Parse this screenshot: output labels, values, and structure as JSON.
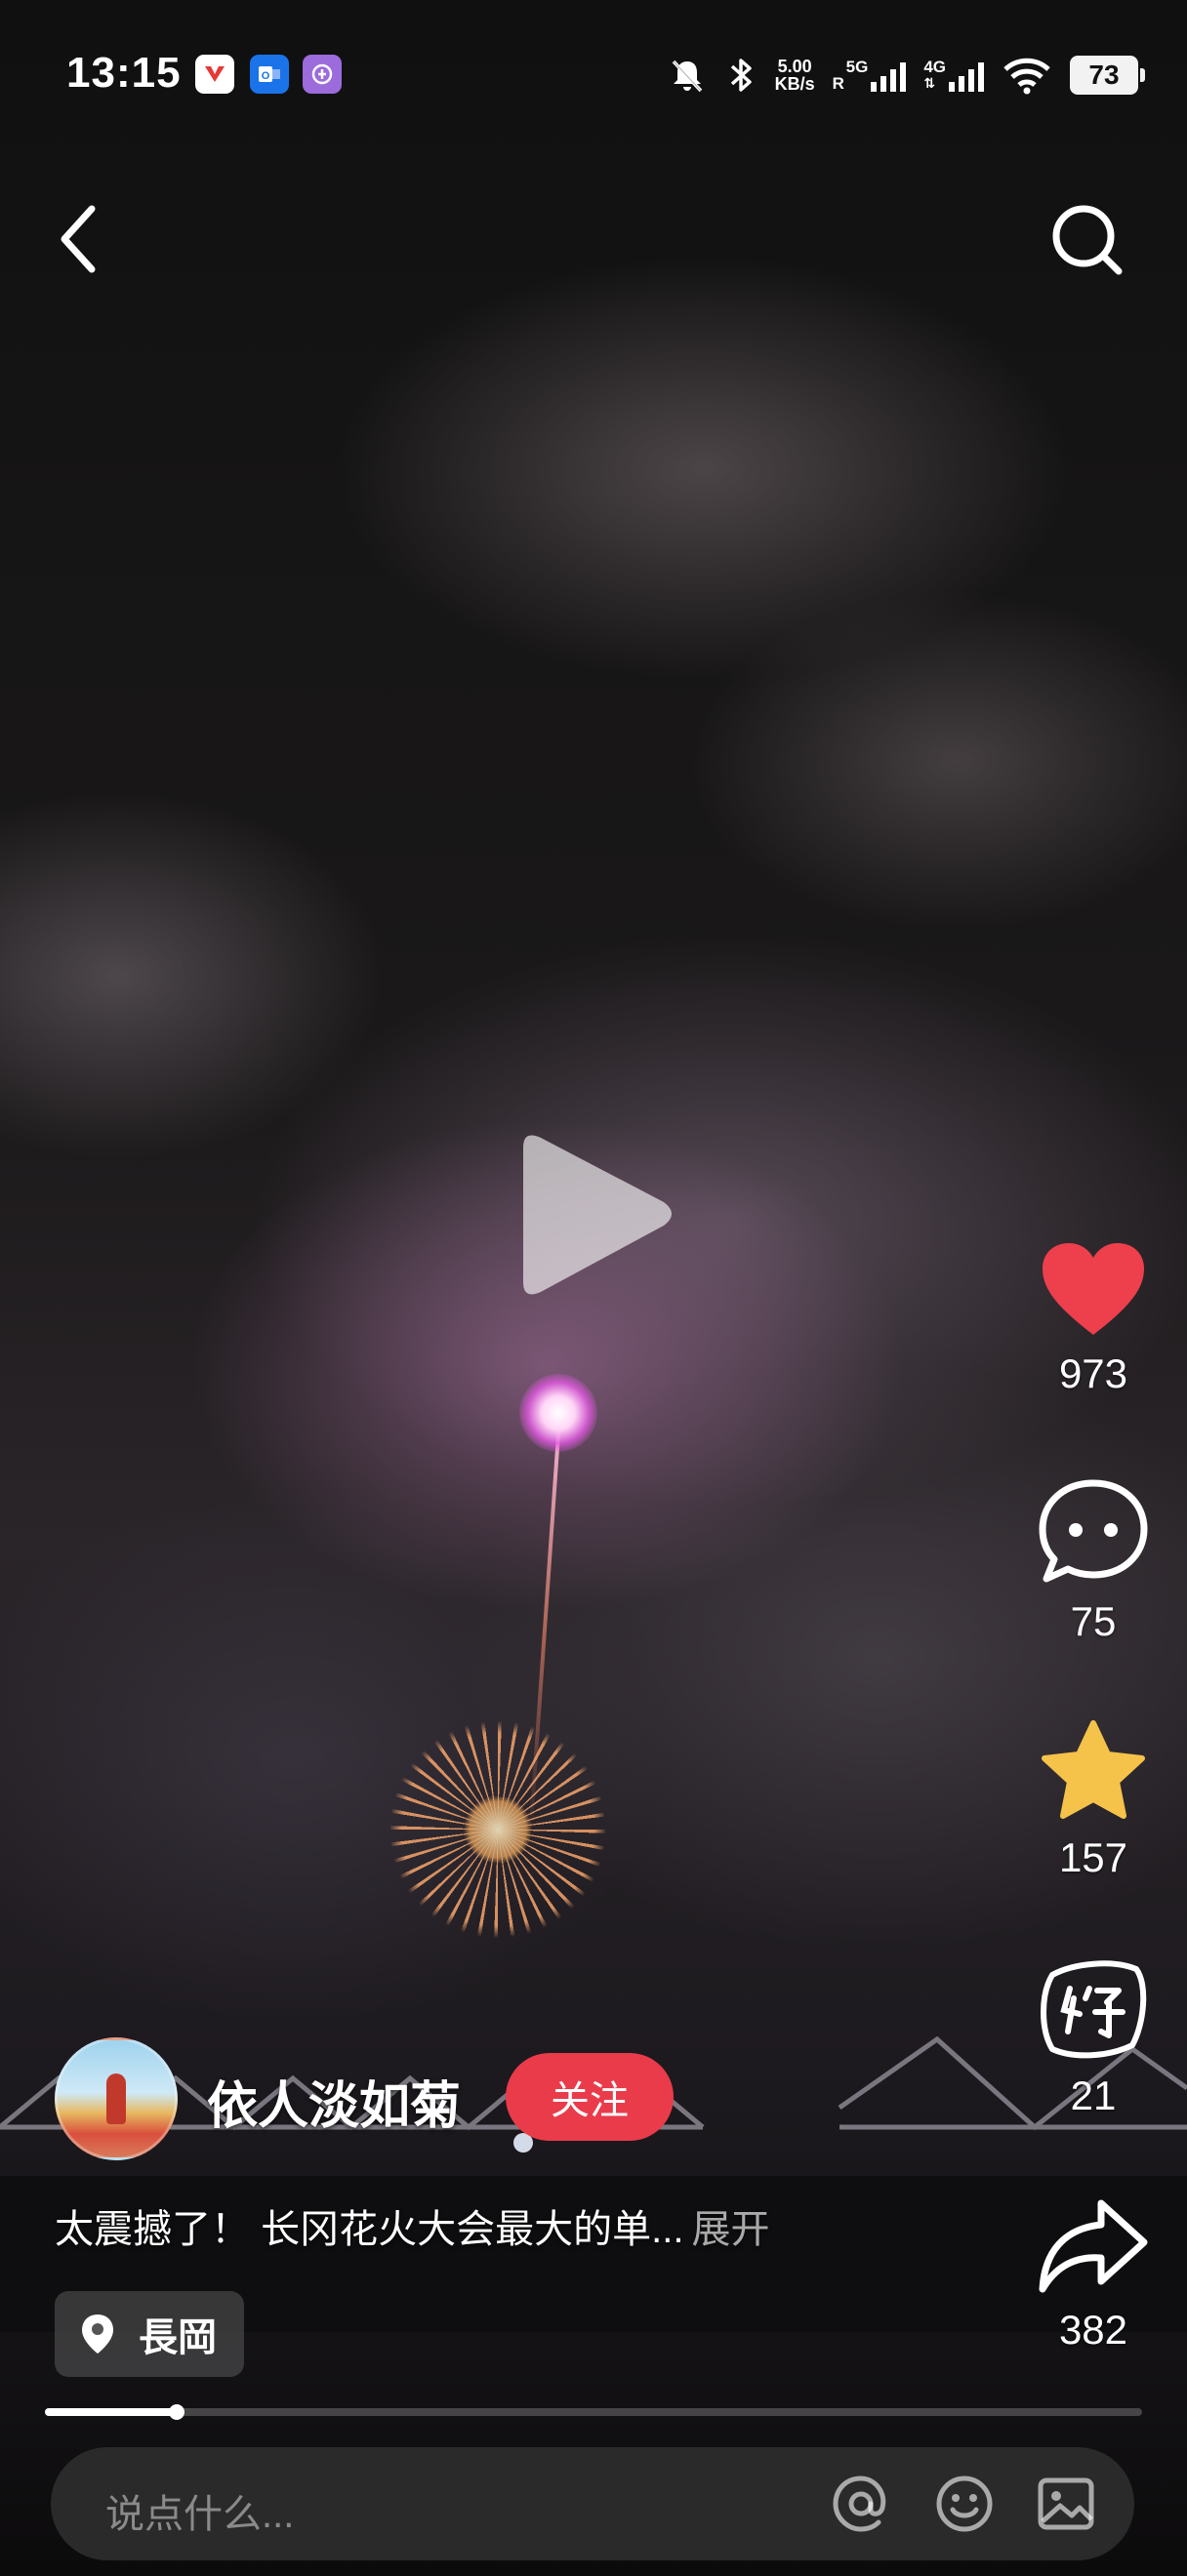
{
  "status_bar": {
    "time": "13:15",
    "app_icons": [
      "app-red-icon",
      "outlook-icon",
      "purple-app-icon"
    ],
    "net_speed_value": "5.00",
    "net_speed_unit": "KB/s",
    "sim1_label": "5G",
    "sim1_sub": "R",
    "sim2_label": "4G",
    "battery": "73"
  },
  "video": {
    "state": "paused",
    "progress": 0.12
  },
  "actions": {
    "like_count": "973",
    "comment_count": "75",
    "favorite_count": "157",
    "good_count": "21",
    "share_count": "382",
    "like_color": "#ee3f4d",
    "favorite_color": "#f5c24a"
  },
  "author": {
    "name": "依人淡如菊",
    "follow_label": "关注",
    "follow_color": "#ea3b4b"
  },
  "caption": {
    "text": "太震撼了！ 长冈花火大会最大的单...",
    "more_label": "展开"
  },
  "location": {
    "label": "長岡"
  },
  "comment_bar": {
    "placeholder": "说点什么..."
  }
}
